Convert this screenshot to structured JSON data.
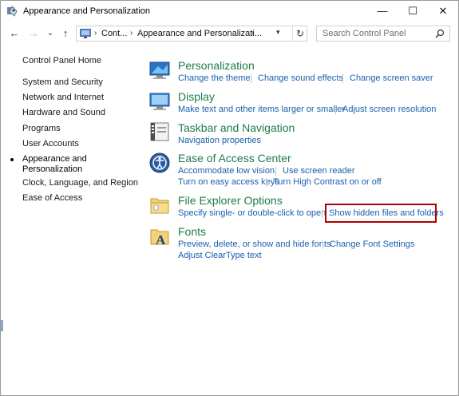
{
  "window": {
    "title": "Appearance and Personalization",
    "minimize_glyph": "—",
    "maximize_glyph": "☐",
    "close_glyph": "✕"
  },
  "nav": {
    "back_glyph": "←",
    "forward_glyph": "→",
    "recent_glyph": "⌄",
    "up_glyph": "↑",
    "breadcrumbs": [
      "Cont...",
      "Appearance and Personalizati..."
    ],
    "separator": "›",
    "refresh_glyph": "↻",
    "search_placeholder": "Search Control Panel"
  },
  "sidebar": {
    "items": [
      "Control Panel Home",
      "System and Security",
      "Network and Internet",
      "Hardware and Sound",
      "Programs",
      "User Accounts",
      "Appearance and",
      "Personalization",
      "Clock, Language, and Region",
      "Ease of Access"
    ]
  },
  "categories": [
    {
      "title": "Personalization",
      "icon": "personalization-icon",
      "links": [
        "Change the theme",
        "Change sound effects",
        "Change screen saver"
      ]
    },
    {
      "title": "Display",
      "icon": "display-icon",
      "links": [
        "Make text and other items larger or smaller",
        "Adjust screen resolution"
      ]
    },
    {
      "title": "Taskbar and Navigation",
      "icon": "taskbar-icon",
      "links": [
        "Navigation properties"
      ]
    },
    {
      "title": "Ease of Access Center",
      "icon": "ease-of-access-icon",
      "links": [
        "Accommodate low vision",
        "Use screen reader",
        "Turn on easy access keys",
        "Turn High Contrast on or off"
      ]
    },
    {
      "title": "File Explorer Options",
      "icon": "folder-options-icon",
      "links": [
        "Specify single- or double-click to open",
        "Show hidden files and folders"
      ]
    },
    {
      "title": "Fonts",
      "icon": "fonts-icon",
      "links": [
        "Preview, delete, or show and hide fonts",
        "Change Font Settings",
        "Adjust ClearType text"
      ]
    }
  ],
  "colors": {
    "category_title": "#1e7b4a",
    "link": "#1a5fae",
    "highlight_box": "#b00000"
  }
}
